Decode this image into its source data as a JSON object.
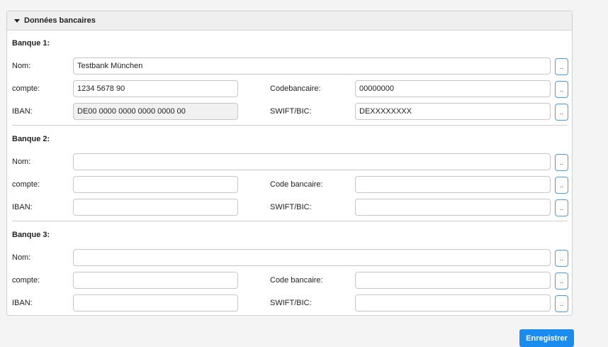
{
  "panel": {
    "title": "Données bancaires"
  },
  "banks": [
    {
      "title": "Banque 1:",
      "name_label": "Nom:",
      "account_label": "compte:",
      "bankcode_label": "Codebancaire:",
      "iban_label": "IBAN:",
      "swift_label": "SWIFT/BIC:",
      "name_value": "Testbank München",
      "account_value": "1234 5678 90",
      "bankcode_value": "00000000",
      "iban_value": "DE00 0000 0000 0000 0000 00",
      "swift_value": "DEXXXXXXXX",
      "btn_label": ".."
    },
    {
      "title": "Banque 2:",
      "name_label": "Nom:",
      "account_label": "compte:",
      "bankcode_label": "Code bancaire:",
      "iban_label": "IBAN:",
      "swift_label": "SWIFT/BIC:",
      "name_value": "",
      "account_value": "",
      "bankcode_value": "",
      "iban_value": "",
      "swift_value": "",
      "btn_label": ".."
    },
    {
      "title": "Banque 3:",
      "name_label": "Nom:",
      "account_label": "compte:",
      "bankcode_label": "Code bancaire:",
      "iban_label": "IBAN:",
      "swift_label": "SWIFT/BIC:",
      "name_value": "",
      "account_value": "",
      "bankcode_value": "",
      "iban_value": "",
      "swift_value": "",
      "btn_label": ".."
    }
  ],
  "save_label": "Enregistrer"
}
